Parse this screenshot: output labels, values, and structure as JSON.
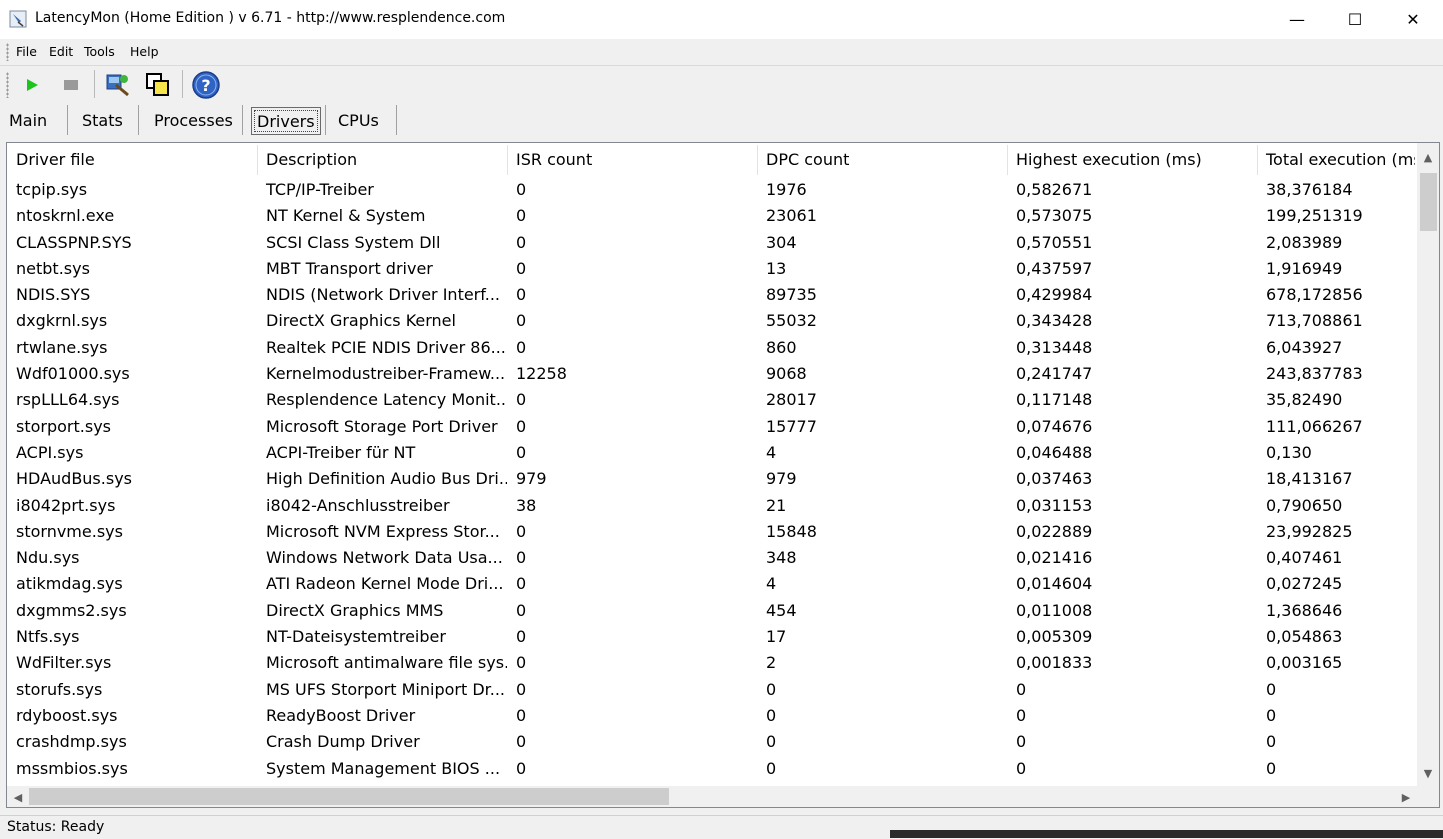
{
  "window": {
    "title": "LatencyMon  (Home Edition )  v 6.71 - http://www.resplendence.com",
    "minimize_glyph": "—",
    "maximize_glyph": "☐",
    "close_glyph": "✕"
  },
  "menu": [
    "File",
    "Edit",
    "Tools",
    "Help"
  ],
  "toolbar": {
    "buttons": [
      "play-icon",
      "stop-icon",
      "driver-tool-icon",
      "windows-icon",
      "help-icon"
    ],
    "help_glyph": "?"
  },
  "tabs": [
    {
      "label": "Main"
    },
    {
      "label": "Stats"
    },
    {
      "label": "Processes"
    },
    {
      "label": "Drivers",
      "active": true
    },
    {
      "label": "CPUs"
    }
  ],
  "table": {
    "columns": [
      "Driver file",
      "Description",
      "ISR count",
      "DPC count",
      "Highest execution (ms)",
      "Total execution (ms)"
    ],
    "rows": [
      [
        "tcpip.sys",
        "TCP/IP-Treiber",
        "0",
        "1976",
        "0,582671",
        "38,376184"
      ],
      [
        "ntoskrnl.exe",
        "NT Kernel & System",
        "0",
        "23061",
        "0,573075",
        "199,251319"
      ],
      [
        "CLASSPNP.SYS",
        "SCSI Class System Dll",
        "0",
        "304",
        "0,570551",
        "2,083989"
      ],
      [
        "netbt.sys",
        "MBT Transport driver",
        "0",
        "13",
        "0,437597",
        "1,916949"
      ],
      [
        "NDIS.SYS",
        "NDIS (Network Driver Interf...",
        "0",
        "89735",
        "0,429984",
        "678,172856"
      ],
      [
        "dxgkrnl.sys",
        "DirectX Graphics Kernel",
        "0",
        "55032",
        "0,343428",
        "713,708861"
      ],
      [
        "rtwlane.sys",
        "Realtek PCIE NDIS Driver 86...",
        "0",
        "860",
        "0,313448",
        "6,043927"
      ],
      [
        "Wdf01000.sys",
        "Kernelmodustreiber-Framew...",
        "12258",
        "9068",
        "0,241747",
        "243,837783"
      ],
      [
        "rspLLL64.sys",
        "Resplendence Latency Monit...",
        "0",
        "28017",
        "0,117148",
        "35,82490"
      ],
      [
        "storport.sys",
        "Microsoft Storage Port Driver",
        "0",
        "15777",
        "0,074676",
        "111,066267"
      ],
      [
        "ACPI.sys",
        "ACPI-Treiber für NT",
        "0",
        "4",
        "0,046488",
        "0,130"
      ],
      [
        "HDAudBus.sys",
        "High Definition Audio Bus Dri...",
        "979",
        "979",
        "0,037463",
        "18,413167"
      ],
      [
        "i8042prt.sys",
        "i8042-Anschlusstreiber",
        "38",
        "21",
        "0,031153",
        "0,790650"
      ],
      [
        "stornvme.sys",
        "Microsoft NVM Express Stor...",
        "0",
        "15848",
        "0,022889",
        "23,992825"
      ],
      [
        "Ndu.sys",
        "Windows Network Data Usa...",
        "0",
        "348",
        "0,021416",
        "0,407461"
      ],
      [
        "atikmdag.sys",
        "ATI Radeon Kernel Mode Dri...",
        "0",
        "4",
        "0,014604",
        "0,027245"
      ],
      [
        "dxgmms2.sys",
        "DirectX Graphics MMS",
        "0",
        "454",
        "0,011008",
        "1,368646"
      ],
      [
        "Ntfs.sys",
        "NT-Dateisystemtreiber",
        "0",
        "17",
        "0,005309",
        "0,054863"
      ],
      [
        "WdFilter.sys",
        "Microsoft antimalware file sys...",
        "0",
        "2",
        "0,001833",
        "0,003165"
      ],
      [
        "storufs.sys",
        "MS UFS Storport Miniport Dr...",
        "0",
        "0",
        "0",
        "0"
      ],
      [
        "rdyboost.sys",
        "ReadyBoost Driver",
        "0",
        "0",
        "0",
        "0"
      ],
      [
        "crashdmp.sys",
        "Crash Dump Driver",
        "0",
        "0",
        "0",
        "0"
      ],
      [
        "mssmbios.sys",
        "System Management BIOS ...",
        "0",
        "0",
        "0",
        "0"
      ]
    ]
  },
  "scroll": {
    "up": "▲",
    "down": "▼",
    "left": "◀",
    "right": "▶"
  },
  "status": {
    "text": "Status: Ready"
  }
}
